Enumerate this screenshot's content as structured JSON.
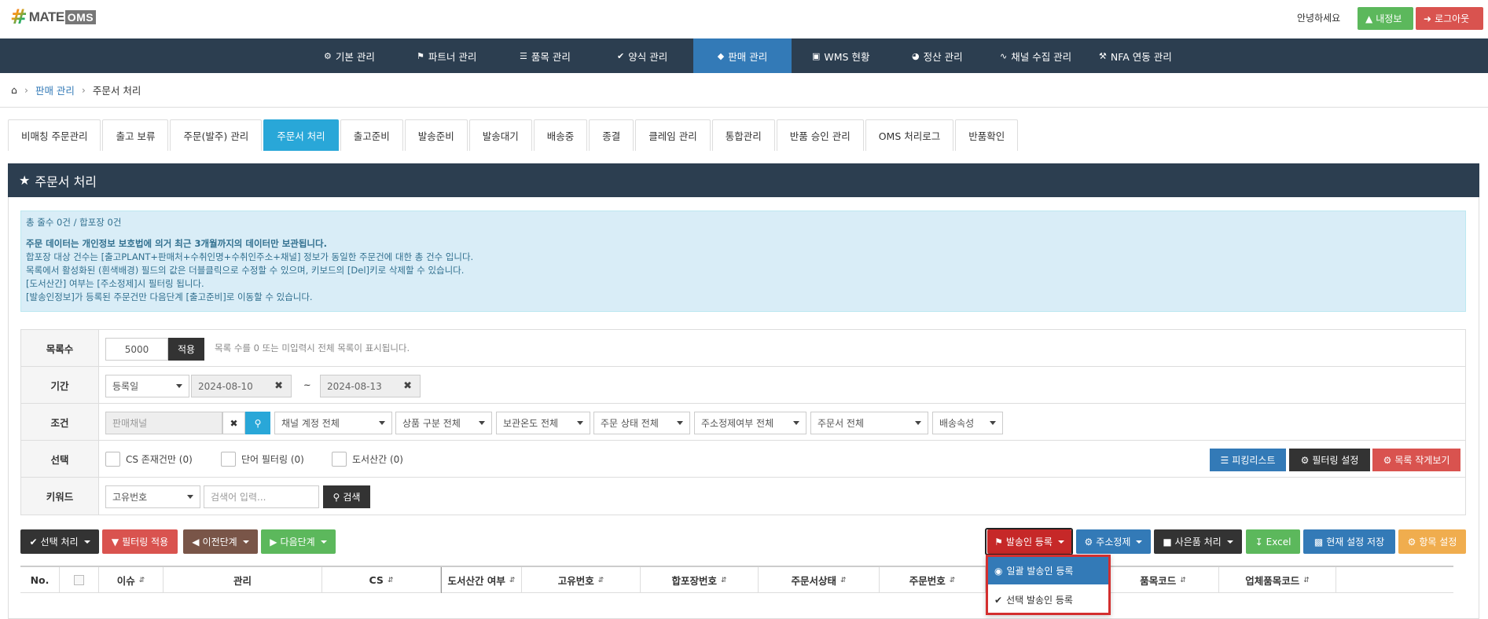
{
  "header": {
    "logo_mate": "MATE",
    "logo_oms": "OMS",
    "greeting": "안녕하세요",
    "myinfo_label": "내정보",
    "logout_label": "로그아웃"
  },
  "nav": {
    "items": [
      {
        "label": "기본 관리",
        "icon": "gear-icon"
      },
      {
        "label": "파트너 관리",
        "icon": "lock-icon"
      },
      {
        "label": "품목 관리",
        "icon": "list-icon"
      },
      {
        "label": "양식 관리",
        "icon": "check-icon"
      },
      {
        "label": "판매 관리",
        "icon": "diamond-icon",
        "active": true
      },
      {
        "label": "WMS 현황",
        "icon": "card-icon"
      },
      {
        "label": "정산 관리",
        "icon": "pie-icon"
      },
      {
        "label": "채널 수집 관리",
        "icon": "rss-icon"
      },
      {
        "label": "NFA 연동 관리",
        "icon": "wrench-icon"
      }
    ]
  },
  "breadcrumb": {
    "section": "판매 관리",
    "current": "주문서 처리"
  },
  "tabs": [
    "비매칭 주문관리",
    "출고 보류",
    "주문(발주) 관리",
    "주문서 처리",
    "출고준비",
    "발송준비",
    "발송대기",
    "배송중",
    "종결",
    "클레임 관리",
    "통합관리",
    "반품 승인 관리",
    "OMS 처리로그",
    "반품확인"
  ],
  "active_tab": "주문서 처리",
  "panel_title": "주문서 처리",
  "info": {
    "line1": "총 줄수 0건 / 합포장 0건",
    "line2": "주문 데이터는 개인정보 보호법에 의거 최근 3개월까지의 데이터만 보관됩니다.",
    "line3": "합포장 대상 건수는 [출고PLANT+판매처+수취인명+수취인주소+채널] 정보가 동일한 주문건에 대한 총 건수 입니다.",
    "line4": "목록에서 활성화된 (흰색배경) 필드의 값은 더블클릭으로 수정할 수 있으며, 키보드의 [Del]키로 삭제할 수 있습니다.",
    "line5": "[도서산간] 여부는 [주소정제]시 필터링 됩니다.",
    "line6": "[발송인정보]가 등록된 주문건만 다음단계 [출고준비]로 이동할 수 있습니다."
  },
  "filters": {
    "list_count": {
      "label": "목록수",
      "value": "5000",
      "apply": "적용",
      "hint": "목록 수를 0 또는 미입력시 전체 목록이 표시됩니다."
    },
    "period": {
      "label": "기간",
      "type": "등록일",
      "from": "2024-08-10",
      "tilde": "~",
      "to": "2024-08-13"
    },
    "condition": {
      "label": "조건",
      "channel_placeholder": "판매채널",
      "selects": [
        "채널 계정 전체",
        "상품 구분 전체",
        "보관온도 전체",
        "주문 상태 전체",
        "주소정제여부 전체",
        "주문서 전체",
        "배송속성"
      ]
    },
    "select": {
      "label": "선택",
      "options": [
        "CS 존재건만 (0)",
        "단어 필터링 (0)",
        "도서산간 (0)"
      ],
      "picking": "피킹리스트",
      "filter_settings": "필터링 설정",
      "list_small": "목록 작게보기"
    },
    "keyword": {
      "label": "키워드",
      "field": "고유번호",
      "placeholder": "검색어 입력...",
      "search": "검색"
    }
  },
  "actions": {
    "select_process": "선택 처리",
    "filter_apply": "필터링 적용",
    "prev_step": "이전단계",
    "next_step": "다음단계",
    "sender_register": "발송인 등록",
    "address_refine": "주소정제",
    "gift_process": "사은품 처리",
    "excel": "Excel",
    "save_settings": "현재 설정 저장",
    "column_settings": "항목 설정"
  },
  "dropdown": {
    "bulk": "일괄 발송인 등록",
    "selected": "선택 발송인 등록"
  },
  "table_headers": [
    "No.",
    "",
    "이슈",
    "관리",
    "CS",
    "도서산간 여부",
    "고유번호",
    "합포장번호",
    "주문서상태",
    "주문번호",
    "",
    "품목코드",
    "업체품목코드"
  ],
  "colors": {
    "nav_bg": "#2c3e50",
    "active_nav": "#337ab7",
    "active_tab": "#29a7d8",
    "info_bg": "#d9edf7"
  }
}
